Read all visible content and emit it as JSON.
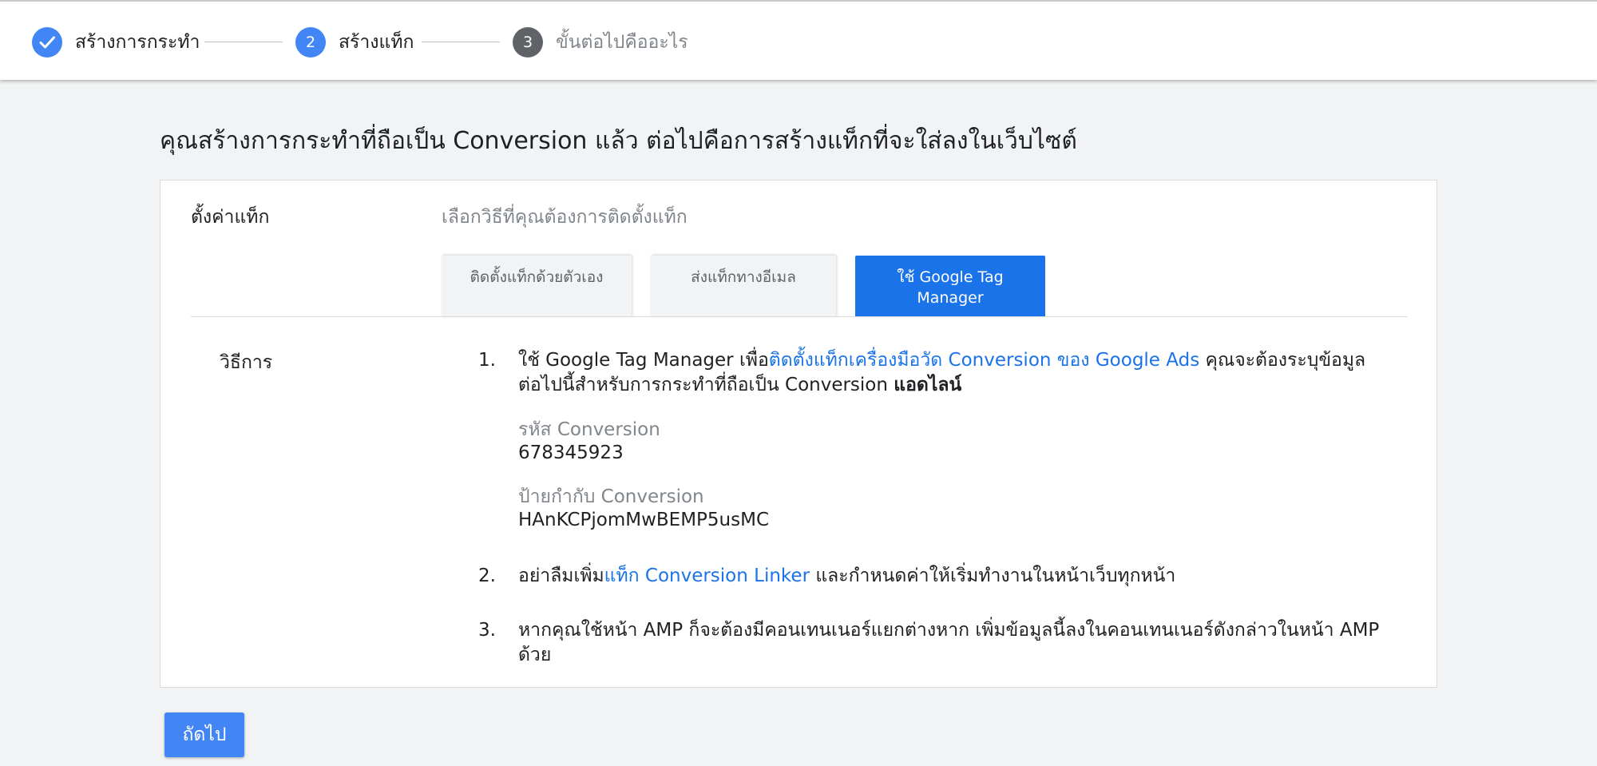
{
  "stepper": {
    "steps": [
      {
        "number": "",
        "label": "สร้างการกระทำ",
        "state": "done"
      },
      {
        "number": "2",
        "label": "สร้างแท็ก",
        "state": "active"
      },
      {
        "number": "3",
        "label": "ขั้นต่อไปคืออะไร",
        "state": "upcoming"
      }
    ]
  },
  "heading": "คุณสร้างการกระทำที่ถือเป็น Conversion แล้ว ต่อไปคือการสร้างแท็กที่จะใส่ลงในเว็บไซต์",
  "card": {
    "setup_label": "ตั้งค่าแท็ก",
    "setup_hint": "เลือกวิธีที่คุณต้องการติดตั้งแท็ก",
    "tabs": [
      {
        "label": "ติดตั้งแท็กด้วยตัวเอง",
        "selected": false
      },
      {
        "label": "ส่งแท็กทางอีเมล",
        "selected": false
      },
      {
        "label": "ใช้ Google Tag Manager",
        "selected": true
      }
    ],
    "method_label": "วิธีการ",
    "instructions": {
      "item1": {
        "num": "1.",
        "text_before": "ใช้ Google Tag Manager เพื่อ",
        "link": "ติดตั้งแท็กเครื่องมือวัด Conversion ของ Google Ads",
        "text_after": " คุณจะต้องระบุข้อมูลต่อไปนี้สำหรับการกระทำที่ถือเป็น Conversion ",
        "bold": "แอดไลน์",
        "conversion_id_label": "รหัส Conversion",
        "conversion_id_value": "678345923",
        "conversion_label_label": "ป้ายกำกับ Conversion",
        "conversion_label_value": "HAnKCPjomMwBEMP5usMC"
      },
      "item2": {
        "num": "2.",
        "text_before": "อย่าลืมเพิ่ม",
        "link": "แท็ก Conversion Linker",
        "text_after": " และกำหนดค่าให้เริ่มทำงานในหน้าเว็บทุกหน้า"
      },
      "item3": {
        "num": "3.",
        "text": "หากคุณใช้หน้า AMP ก็จะต้องมีคอนเทนเนอร์แยกต่างหาก เพิ่มข้อมูลนี้ลงในคอนเทนเนอร์ดังกล่าวในหน้า AMP ด้วย"
      }
    }
  },
  "next_button": "ถัดไป",
  "icons": {
    "step1": "checkmark-icon"
  },
  "colors": {
    "accent": "#4285f4",
    "link": "#1a73e8",
    "selected_tab": "#1a73e8"
  }
}
